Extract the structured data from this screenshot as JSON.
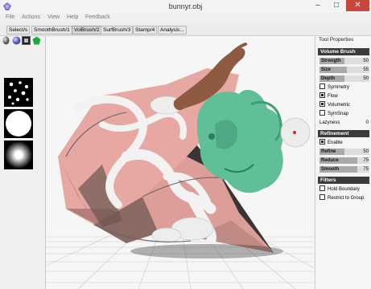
{
  "window": {
    "title": "bunnyr.obj",
    "minimize_glyph": "–",
    "maximize_glyph": "□",
    "close_glyph": "✕"
  },
  "menu": [
    "File",
    "Actions",
    "View",
    "Help",
    "Feedback"
  ],
  "toolbar": {
    "buttons": [
      "Select/s",
      "SmoothBrush/1",
      "VolBrush/2",
      "SurfBrush/3",
      "Stamp/4",
      "Analysis..."
    ],
    "active_index": 2
  },
  "left_panel": {
    "tab_icons": [
      "sphere-icon",
      "sphere-icon",
      "square-icon",
      "pentagon-icon"
    ]
  },
  "right_panel": {
    "title": "Tool Properties",
    "volume_brush": {
      "header": "Volume Brush",
      "sliders": [
        {
          "label": "Strength",
          "value": "50",
          "level": 0.5
        },
        {
          "label": "Size",
          "value": "55",
          "level": 0.55
        },
        {
          "label": "Depth",
          "value": "50",
          "level": 0.5
        }
      ],
      "checks": [
        {
          "label": "Symmetry",
          "checked": false
        },
        {
          "label": "Flow",
          "checked": true
        },
        {
          "label": "Volumetric",
          "checked": true
        },
        {
          "label": "SymSnap",
          "checked": false
        }
      ],
      "lazyness": {
        "label": "Lazyness",
        "value": "0"
      }
    },
    "refinement": {
      "header": "Refinement",
      "enable": {
        "label": "Enable",
        "checked": true
      },
      "sliders": [
        {
          "label": "Refine",
          "value": "50",
          "level": 0.5
        },
        {
          "label": "Reduce",
          "value": "75",
          "level": 0.75
        },
        {
          "label": "Smooth",
          "value": "75",
          "level": 0.75
        }
      ]
    },
    "filters": {
      "header": "Filters",
      "checks": [
        {
          "label": "Hold Boundary",
          "checked": false
        },
        {
          "label": "Restrict to Group",
          "checked": false
        }
      ]
    }
  }
}
